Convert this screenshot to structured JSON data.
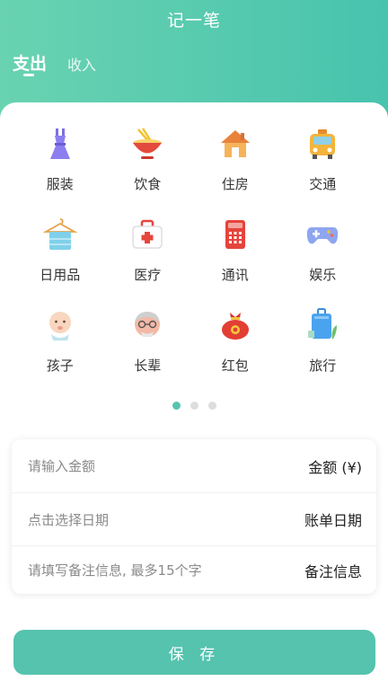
{
  "header": {
    "title": "记一笔",
    "tabs": [
      {
        "label": "支出",
        "active": true
      },
      {
        "label": "收入",
        "active": false
      }
    ]
  },
  "categories": [
    {
      "label": "服装",
      "icon": "dress-icon"
    },
    {
      "label": "饮食",
      "icon": "noodle-bowl-icon"
    },
    {
      "label": "住房",
      "icon": "house-icon"
    },
    {
      "label": "交通",
      "icon": "taxi-icon"
    },
    {
      "label": "日用品",
      "icon": "towel-hanger-icon"
    },
    {
      "label": "医疗",
      "icon": "medical-kit-icon"
    },
    {
      "label": "通讯",
      "icon": "telephone-icon"
    },
    {
      "label": "娱乐",
      "icon": "gamepad-icon"
    },
    {
      "label": "孩子",
      "icon": "baby-icon"
    },
    {
      "label": "长辈",
      "icon": "grandpa-icon"
    },
    {
      "label": "红包",
      "icon": "red-envelope-bag-icon"
    },
    {
      "label": "旅行",
      "icon": "suitcase-icon"
    }
  ],
  "pagination": {
    "page_count": 3,
    "current_page": 1
  },
  "form": {
    "amount": {
      "placeholder": "请输入金额",
      "label": "金额 (¥)"
    },
    "date": {
      "placeholder": "点击选择日期",
      "label": "账单日期"
    },
    "note": {
      "placeholder": "请填写备注信息, 最多15个字",
      "label": "备注信息"
    }
  },
  "save_button": {
    "label": "保 存"
  },
  "colors": {
    "accent": "#55c3ae",
    "header_gradient_start": "#69d3b0",
    "header_gradient_end": "#48c3ae"
  }
}
